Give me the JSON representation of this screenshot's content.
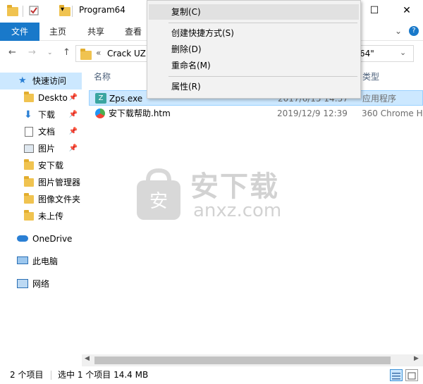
{
  "window": {
    "title": "Program64",
    "minimize": "—",
    "maximize": "☐",
    "close": "✕"
  },
  "ribbon": {
    "tabs": [
      "文件",
      "主页",
      "共享",
      "查看"
    ],
    "expand": "⌄",
    "help": "?"
  },
  "address": {
    "path": "Crack UZ1",
    "tail": "64\"",
    "overflow": "«"
  },
  "sidebar": {
    "quick_access": "快速访问",
    "items": [
      {
        "label": "Deskto",
        "pinned": true
      },
      {
        "label": "下载",
        "pinned": true
      },
      {
        "label": "文档",
        "pinned": true
      },
      {
        "label": "图片",
        "pinned": true
      },
      {
        "label": "安下载",
        "pinned": false
      },
      {
        "label": "图片管理器",
        "pinned": false
      },
      {
        "label": "图像文件夹",
        "pinned": false
      },
      {
        "label": "未上传",
        "pinned": false
      }
    ],
    "onedrive": "OneDrive",
    "this_pc": "此电脑",
    "network": "网络"
  },
  "columns": {
    "name": "名称",
    "type": "类型"
  },
  "files": [
    {
      "name": "Zps.exe",
      "date": "2017/6/15 14:57",
      "type": "应用程序"
    },
    {
      "name": "安下载帮助.htm",
      "date": "2019/12/9 12:39",
      "type": "360 Chrome H"
    }
  ],
  "status": {
    "count": "2 个项目",
    "selection": "选中 1 个项目  14.4 MB"
  },
  "context_menu": {
    "items": [
      {
        "label": "复制(C)"
      },
      {
        "label": "创建快捷方式(S)"
      },
      {
        "label": "删除(D)"
      },
      {
        "label": "重命名(M)"
      },
      {
        "label": "属性(R)"
      }
    ]
  },
  "watermark": {
    "brand": "安下载",
    "domain": "anxz.com"
  },
  "colors": {
    "accent": "#1979ca",
    "selection": "#cce8ff"
  }
}
